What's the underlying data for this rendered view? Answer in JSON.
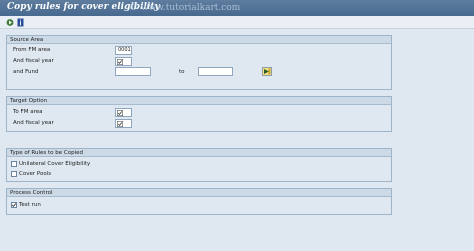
{
  "title": "Copy rules for cover eligibility",
  "watermark": "© www.tutorialkart.com",
  "toolbar": {
    "icons": [
      "execute-icon",
      "info-icon"
    ]
  },
  "source_area": {
    "title": "Source Area",
    "fm_area_label": "From FM area",
    "fm_area_value": "0001",
    "fiscal_year_label": "And fiscal year",
    "fiscal_year_value": "",
    "fund_label": "and Fund",
    "fund_from": "",
    "to_label": "to",
    "fund_to": ""
  },
  "target_option": {
    "title": "Target Option",
    "fm_area_label": "To FM area",
    "fm_area_value": "",
    "fiscal_year_label": "And fiscal year",
    "fiscal_year_value": ""
  },
  "rules_type": {
    "title": "Type of Rules to be Copied",
    "option1": "Unilateral Cover Eligibility",
    "option1_checked": false,
    "option2": "Cover Pools",
    "option2_checked": false
  },
  "process_control": {
    "title": "Process Control",
    "test_run_label": "Test run",
    "test_run_checked": true
  }
}
